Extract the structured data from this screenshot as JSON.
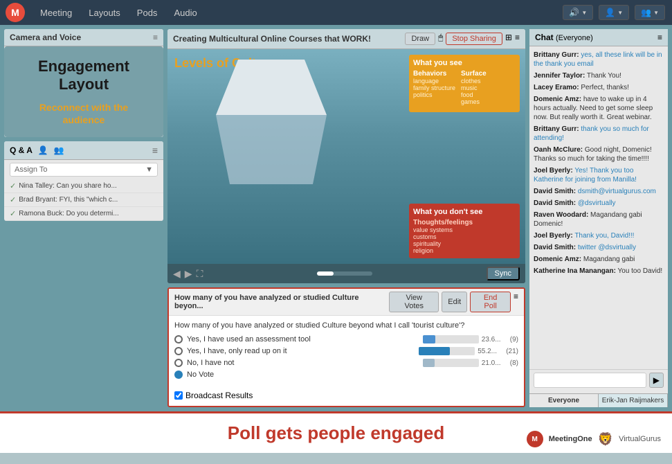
{
  "menubar": {
    "logo": "M",
    "items": [
      "Meeting",
      "Layouts",
      "Pods",
      "Audio"
    ],
    "buttons": [
      "🔊",
      "👤",
      "👥"
    ]
  },
  "left_panel": {
    "title": "Camera and Voice",
    "engagement": {
      "title": "Engagement\nLayout",
      "subtitle": "Reconnect with the\naudience"
    },
    "qa": {
      "title": "Q & A",
      "filter": "Assign To",
      "items": [
        "Nina Talley: Can you share ho...",
        "Brad Bryant: FYI, this \"which c...",
        "Ramona Buck: Do you determi..."
      ]
    }
  },
  "center": {
    "share_title": "Creating Multicultural Online Courses that WORK!",
    "draw_btn": "Draw",
    "stop_sharing_btn": "Stop Sharing",
    "sync_btn": "Sync",
    "slide": {
      "title": "Levels of Culture",
      "box_top_title": "What you see",
      "box_top_behaviors": "Behaviors",
      "box_top_behavior_items": [
        "language",
        "family structure",
        "politics"
      ],
      "box_top_surface": "Surface",
      "box_top_surface_items": [
        "clothes",
        "music",
        "food",
        "games"
      ],
      "box_bottom_title": "What you don't see",
      "box_bottom_thoughts": "Thoughts/feelings",
      "box_bottom_items": [
        "value systems",
        "customs",
        "spirituality",
        "religion"
      ]
    },
    "poll": {
      "header": "How many of you have analyzed or studied Culture beyon...",
      "view_votes_btn": "View Votes",
      "edit_btn": "Edit",
      "end_poll_btn": "End Poll",
      "question": "How many of you have analyzed or studied Culture beyond what I call 'tourist culture'?",
      "options": [
        {
          "label": "Yes, I have used an assessment tool",
          "pct": 23.6,
          "count": 9,
          "bar": 23
        },
        {
          "label": "Yes, I have, only read up on it",
          "pct": 55.2,
          "count": 21,
          "bar": 55
        },
        {
          "label": "No, I have not",
          "pct": 21.0,
          "count": 8,
          "bar": 21
        },
        {
          "label": "No Vote",
          "selected": true
        }
      ],
      "broadcast_label": "Broadcast Results"
    }
  },
  "chat": {
    "title": "Chat",
    "subtitle": "(Everyone)",
    "messages": [
      {
        "author": "Brittany Gurr:",
        "text": " yes, all these link will be in the thank you email",
        "highlight": true
      },
      {
        "author": "Jennifer Taylor:",
        "text": " Thank You!"
      },
      {
        "author": "Lacey Eramo:",
        "text": " Perfect, thanks!"
      },
      {
        "author": "Domenic Amz:",
        "text": " have to wake up in 4 hours actually. Need to get some sleep now. But really worth it. Great webinar."
      },
      {
        "author": "Brittany Gurr:",
        "text": " thank you so much for attending!",
        "highlight": true
      },
      {
        "author": "Oanh McClure:",
        "text": " Good night, Domenic! Thanks so much for taking the time!!!!"
      },
      {
        "author": "Joel Byerly:",
        "text": " Yes!  Thank you too Katherine for joining from Manilla!",
        "highlight": true
      },
      {
        "author": "David Smith:",
        "text": " dsmith@virtualgurus.com",
        "link": true
      },
      {
        "author": "David Smith:",
        "text": " @dsvirtually",
        "link": true
      },
      {
        "author": "Raven Woodard:",
        "text": " Magandang gabi Domenic!"
      },
      {
        "author": "Joel Byerly:",
        "text": " Thank you, David!!!",
        "highlight": true
      },
      {
        "author": "David Smith:",
        "text": " twitter @dsvirtually",
        "link": true
      },
      {
        "author": "Domenic Amz:",
        "text": " Magandang gabi"
      },
      {
        "author": "Katherine Ina Manangan:",
        "text": " You too David!"
      }
    ],
    "input_placeholder": "",
    "tabs": [
      "Everyone",
      "Erik-Jan Raijmakers"
    ]
  },
  "bottom": {
    "text": "Poll gets people engaged",
    "logo1": "M",
    "logo1_text": "MeetingOne",
    "logo2_text": "VirtualGurus"
  }
}
